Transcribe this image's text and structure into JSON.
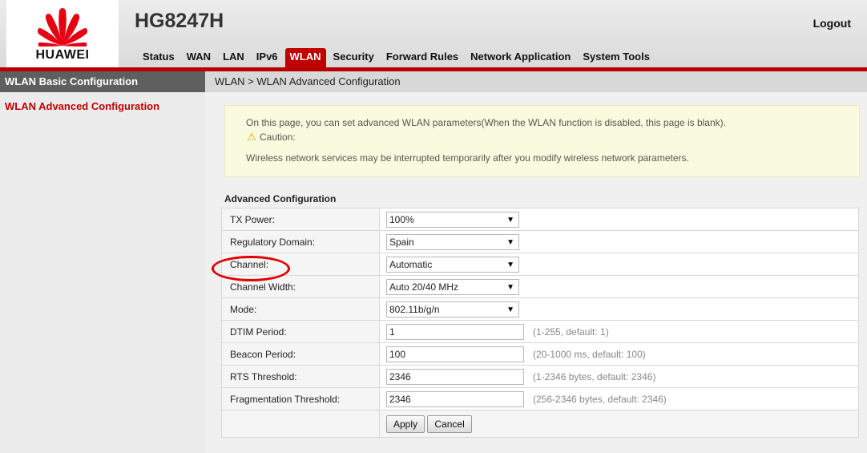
{
  "brand": {
    "logo_text": "HUAWEI",
    "model": "HG8247H",
    "logout_label": "Logout",
    "accent_color": "#c00000"
  },
  "nav": {
    "items": [
      {
        "label": "Status"
      },
      {
        "label": "WAN"
      },
      {
        "label": "LAN"
      },
      {
        "label": "IPv6"
      },
      {
        "label": "WLAN",
        "active": true
      },
      {
        "label": "Security"
      },
      {
        "label": "Forward Rules"
      },
      {
        "label": "Network Application"
      },
      {
        "label": "System Tools"
      }
    ]
  },
  "sidebar": {
    "items": [
      {
        "label": "WLAN Basic Configuration"
      },
      {
        "label": "WLAN Advanced Configuration",
        "active": true
      }
    ]
  },
  "breadcrumb": "WLAN > WLAN Advanced Configuration",
  "info": {
    "line1": "On this page, you can set advanced WLAN parameters(When the WLAN function is disabled, this page is blank).",
    "caution": "Caution:",
    "line3": "Wireless network services may be interrupted temporarily after you modify wireless network parameters.",
    "icon": "warning-icon"
  },
  "section_title": "Advanced Configuration",
  "form": {
    "tx_power": {
      "label": "TX Power:",
      "value": "100%"
    },
    "regulatory_domain": {
      "label": "Regulatory Domain:",
      "value": "Spain"
    },
    "channel": {
      "label": "Channel:",
      "value": "Automatic"
    },
    "channel_width": {
      "label": "Channel Width:",
      "value": "Auto 20/40 MHz"
    },
    "mode": {
      "label": "Mode:",
      "value": "802.11b/g/n"
    },
    "dtim_period": {
      "label": "DTIM Period:",
      "value": "1",
      "hint": "(1-255, default: 1)"
    },
    "beacon_period": {
      "label": "Beacon Period:",
      "value": "100",
      "hint": "(20-1000 ms, default: 100)"
    },
    "rts_threshold": {
      "label": "RTS Threshold:",
      "value": "2346",
      "hint": "(1-2346 bytes, default: 2346)"
    },
    "fragmentation_threshold": {
      "label": "Fragmentation Threshold:",
      "value": "2346",
      "hint": "(256-2346 bytes, default: 2346)"
    }
  },
  "buttons": {
    "apply": "Apply",
    "cancel": "Cancel"
  },
  "annotation": {
    "highlight_color": "#e00000",
    "target": "Channel:"
  }
}
